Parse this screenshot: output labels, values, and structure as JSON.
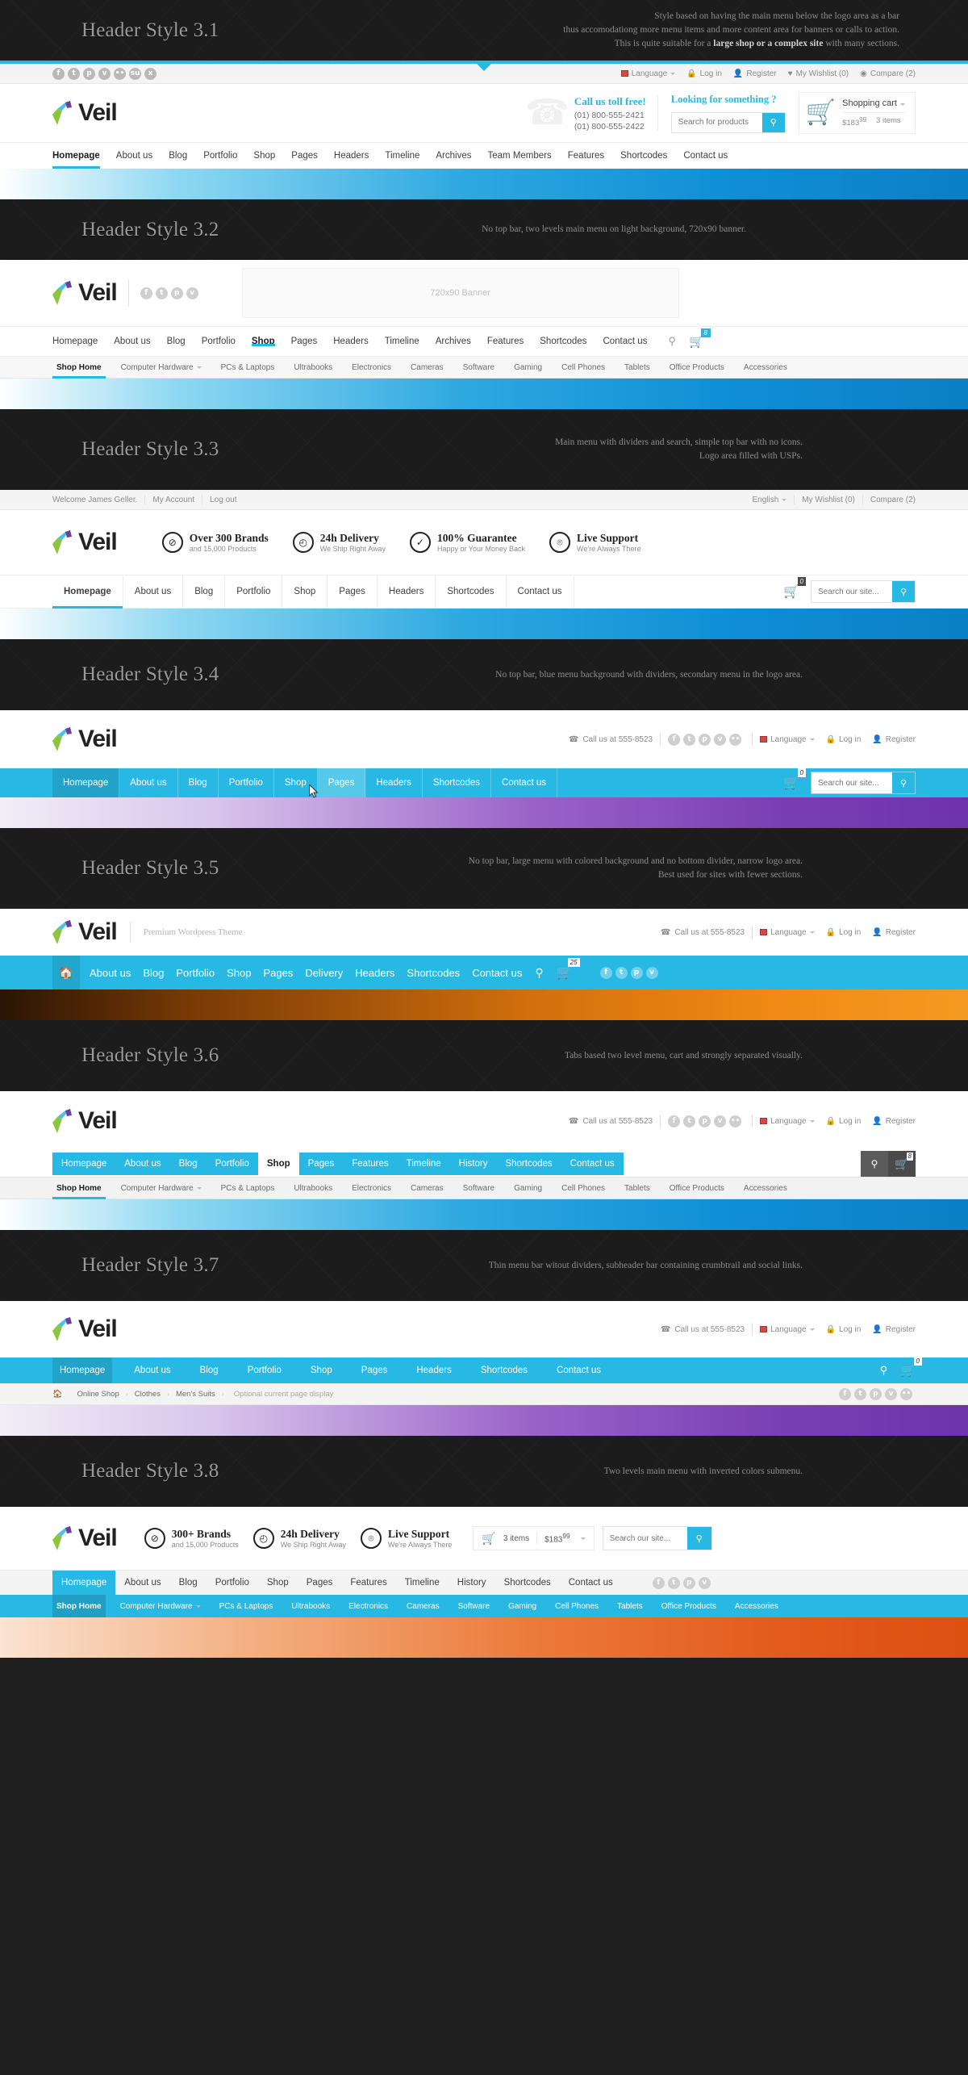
{
  "brand": {
    "name": "Veil",
    "tagline": "Premium Wordpress Theme",
    "accent": "#27b9e4"
  },
  "common": {
    "language": "Language",
    "login": "Log in",
    "register": "Register",
    "wishlist": "My Wishlist (0)",
    "compare": "Compare (2)",
    "call_short": "Call us at 555-8523",
    "search_site_placeholder": "Search our site...",
    "search_products_placeholder": "Search for products",
    "search_icon": "search-icon",
    "cart_icon": "cart-icon"
  },
  "sections": [
    {
      "id": "3.1",
      "title": "Header Style 3.1",
      "desc_lines": [
        "Style based on having the main menu below the logo area as a bar",
        "thus accomodationg more menu items and more content area for banners or calls to action.",
        "This is quite suitable for a "
      ],
      "desc_bold": "large shop or a complex site",
      "desc_tail": " with many sections.",
      "social": [
        "facebook",
        "twitter",
        "pinterest",
        "vimeo",
        "flickr",
        "stumbleupon",
        "xing"
      ],
      "topbar_right": [
        "Language",
        "Log in",
        "Register",
        "My Wishlist (0)",
        "Compare (2)"
      ],
      "call_title": "Call us toll free!",
      "phone1": "(01) 800-555-2421",
      "phone2": "(01) 800-555-2422",
      "search_title": "Looking for something ?",
      "search_placeholder": "Search for products",
      "cart_label": "Shopping cart",
      "cart_price": "$183",
      "cart_price_sup": "99",
      "cart_items": "3 items",
      "menu": [
        "Homepage",
        "About us",
        "Blog",
        "Portfolio",
        "Shop",
        "Pages",
        "Headers",
        "Timeline",
        "Archives",
        "Team Members",
        "Features",
        "Shortcodes",
        "Contact us"
      ],
      "active": "Homepage"
    },
    {
      "id": "3.2",
      "title": "Header Style 3.2",
      "desc_lines": [
        "No top bar, two levels main menu on light background, 720x90 banner."
      ],
      "social": [
        "facebook",
        "twitter",
        "pinterest",
        "vimeo"
      ],
      "banner_text": "720x90 Banner",
      "menu": [
        "Homepage",
        "About us",
        "Blog",
        "Portfolio",
        "Shop",
        "Pages",
        "Headers",
        "Timeline",
        "Archives",
        "Features",
        "Shortcodes",
        "Contact us"
      ],
      "active": "Shop",
      "cart_count": "8",
      "submenu": [
        "Shop Home",
        "Computer Hardware",
        "PCs & Laptops",
        "Ultrabooks",
        "Electronics",
        "Cameras",
        "Software",
        "Gaming",
        "Cell Phones",
        "Tablets",
        "Office Products",
        "Accessories"
      ],
      "submenu_active": "Shop Home",
      "submenu_dropdown": "Computer Hardware"
    },
    {
      "id": "3.3",
      "title": "Header Style 3.3",
      "desc_lines": [
        "Main menu with dividers and search, simple top bar with no icons.",
        "Logo area filled with USPs."
      ],
      "topbar_left": [
        "Welcome James Geller.",
        "My Account",
        "Log out"
      ],
      "topbar_right": [
        "English",
        "My Wishlist (0)",
        "Compare (2)"
      ],
      "usps": [
        {
          "icon": "tag-icon",
          "t1": "Over 300 Brands",
          "t2": "and 15,000 Products"
        },
        {
          "icon": "clock-icon",
          "t1": "24h Delivery",
          "t2": "We Ship Right Away"
        },
        {
          "icon": "check-icon",
          "t1": "100% Guarantee",
          "t2": "Happy or Your Money Back"
        },
        {
          "icon": "headset-icon",
          "t1": "Live Support",
          "t2": "We're Always There"
        }
      ],
      "menu": [
        "Homepage",
        "About us",
        "Blog",
        "Portfolio",
        "Shop",
        "Pages",
        "Headers",
        "Shortcodes",
        "Contact us"
      ],
      "active": "Homepage",
      "cart_count": "0",
      "search_placeholder": "Search our site..."
    },
    {
      "id": "3.4",
      "title": "Header Style 3.4",
      "desc_lines": [
        "No top bar, blue menu background with dividers, secondary menu in the logo area."
      ],
      "call": "Call us at 555-8523",
      "social": [
        "facebook",
        "twitter",
        "pinterest",
        "vimeo",
        "flickr"
      ],
      "secondary": [
        "Language",
        "Log in",
        "Register"
      ],
      "menu": [
        "Homepage",
        "About us",
        "Blog",
        "Portfolio",
        "Shop",
        "Pages",
        "Headers",
        "Shortcodes",
        "Contact us"
      ],
      "active": "Homepage",
      "hover": "Pages",
      "cart_count": "0",
      "search_placeholder": "Search our site..."
    },
    {
      "id": "3.5",
      "title": "Header Style 3.5",
      "desc_lines": [
        "No top bar, large menu with colored background and no bottom divider, narrow logo area.",
        "Best used for sites with fewer sections."
      ],
      "tagline": "Premium Wordpress Theme",
      "call": "Call us at 555-8523",
      "secondary": [
        "Language",
        "Log in",
        "Register"
      ],
      "home_icon": "home-icon",
      "menu": [
        "About us",
        "Blog",
        "Portfolio",
        "Shop",
        "Pages",
        "Delivery",
        "Headers",
        "Shortcodes",
        "Contact us"
      ],
      "cart_count": "25",
      "social": [
        "facebook",
        "twitter",
        "pinterest",
        "vimeo"
      ]
    },
    {
      "id": "3.6",
      "title": "Header Style 3.6",
      "desc_lines": [
        "Tabs based two level menu, cart and strongly separated visually."
      ],
      "call": "Call us at 555-8523",
      "social": [
        "facebook",
        "twitter",
        "pinterest",
        "vimeo",
        "flickr"
      ],
      "secondary": [
        "Language",
        "Log in",
        "Register"
      ],
      "menu": [
        "Homepage",
        "About us",
        "Blog",
        "Portfolio",
        "Shop",
        "Pages",
        "Features",
        "Timeline",
        "History",
        "Shortcodes",
        "Contact us"
      ],
      "active": "Shop",
      "cart_count": "8",
      "submenu": [
        "Shop Home",
        "Computer Hardware",
        "PCs & Laptops",
        "Ultrabooks",
        "Electronics",
        "Cameras",
        "Software",
        "Gaming",
        "Cell Phones",
        "Tablets",
        "Office Products",
        "Accessories"
      ],
      "submenu_active": "Shop Home",
      "submenu_dropdown": "Computer Hardware"
    },
    {
      "id": "3.7",
      "title": "Header Style 3.7",
      "desc_lines": [
        "Thin menu bar witout dividers, subheader bar containing crumbtrail and social links."
      ],
      "call": "Call us at 555-8523",
      "secondary": [
        "Language",
        "Log in",
        "Register"
      ],
      "menu": [
        "Homepage",
        "About us",
        "Blog",
        "Portfolio",
        "Shop",
        "Pages",
        "Headers",
        "Shortcodes",
        "Contact us"
      ],
      "active": "Homepage",
      "cart_count": "0",
      "crumbs": [
        "Online Shop",
        "Clothes",
        "Men's Suits"
      ],
      "crumb_note": "Optional current page display",
      "social": [
        "facebook",
        "twitter",
        "pinterest",
        "vimeo",
        "flickr"
      ]
    },
    {
      "id": "3.8",
      "title": "Header Style 3.8",
      "desc_lines": [
        "Two levels main menu with inverted colors submenu."
      ],
      "usps": [
        {
          "icon": "tag-icon",
          "t1": "300+ Brands",
          "t2": "and 15,000 Products"
        },
        {
          "icon": "clock-icon",
          "t1": "24h Delivery",
          "t2": "We Ship Right Away"
        },
        {
          "icon": "headset-icon",
          "t1": "Live Support",
          "t2": "We're Always There"
        }
      ],
      "cart_items": "3 items",
      "cart_price": "$183",
      "cart_price_sup": "99",
      "search_placeholder": "Search our site...",
      "menu": [
        "Homepage",
        "About us",
        "Blog",
        "Portfolio",
        "Shop",
        "Pages",
        "Features",
        "Timeline",
        "History",
        "Shortcodes",
        "Contact us"
      ],
      "active": "Homepage",
      "social": [
        "facebook",
        "twitter",
        "pinterest",
        "vimeo"
      ],
      "submenu": [
        "Shop Home",
        "Computer Hardware",
        "PCs & Laptops",
        "Ultrabooks",
        "Electronics",
        "Cameras",
        "Software",
        "Gaming",
        "Cell Phones",
        "Tablets",
        "Office Products",
        "Accessories"
      ],
      "submenu_active": "Shop Home",
      "submenu_dropdown": "Computer Hardware"
    }
  ]
}
